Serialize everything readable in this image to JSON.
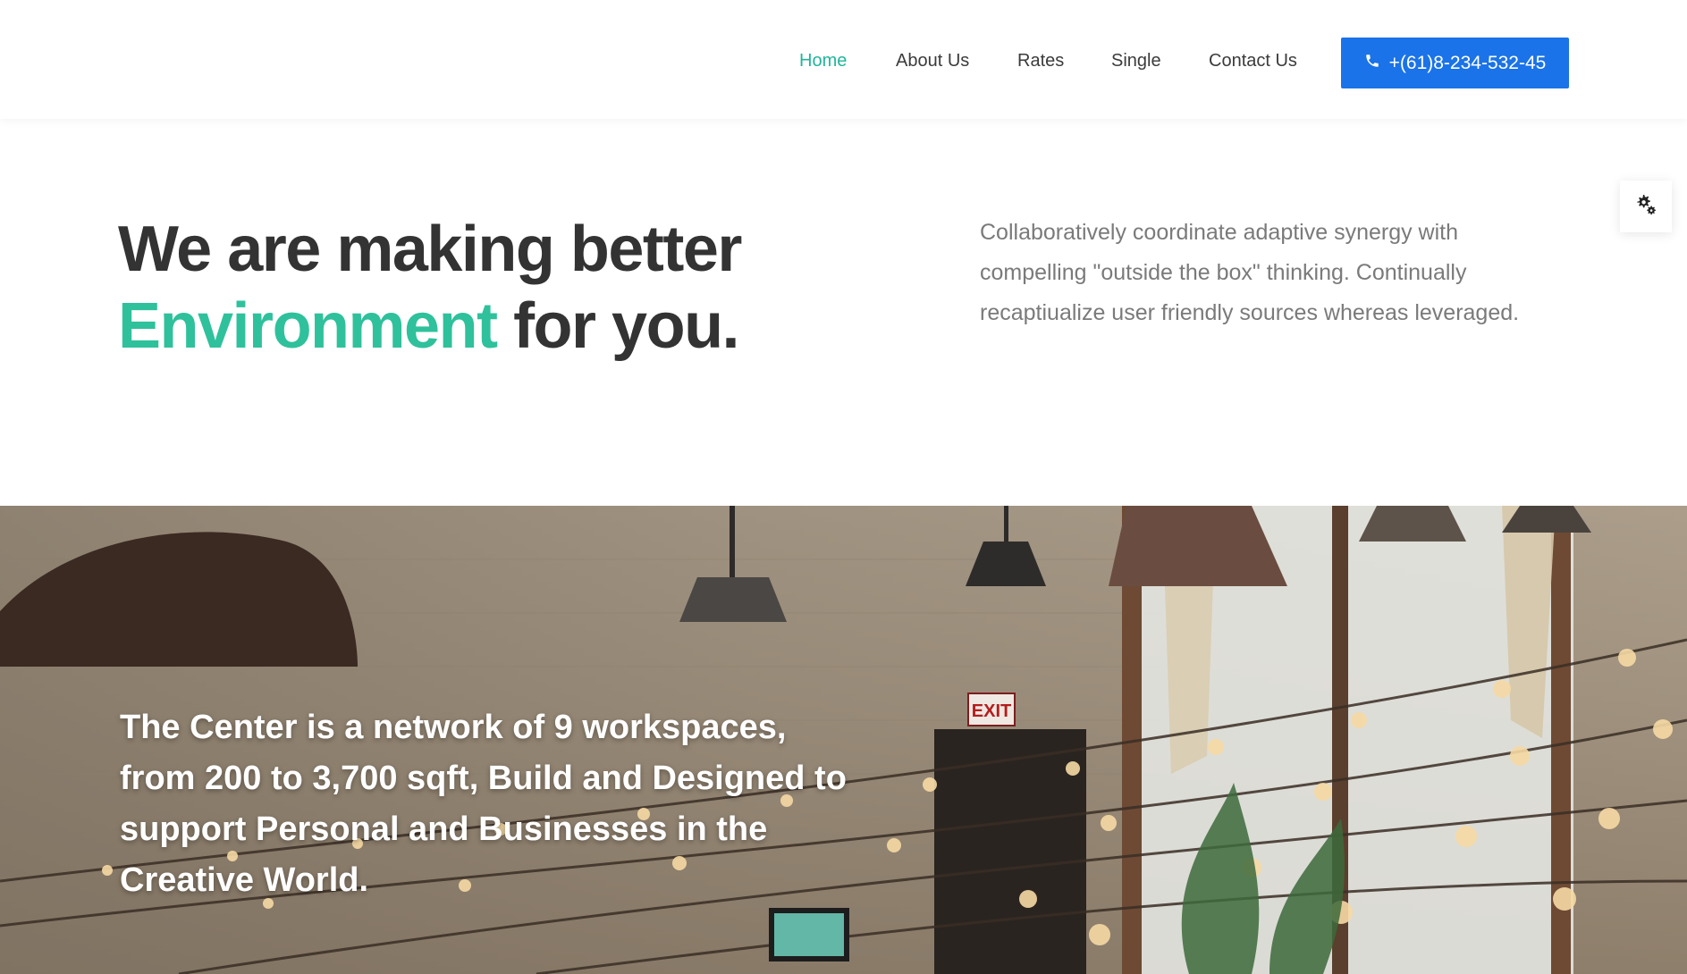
{
  "nav": {
    "items": [
      {
        "label": "Home",
        "active": true
      },
      {
        "label": "About Us",
        "active": false
      },
      {
        "label": "Rates",
        "active": false
      },
      {
        "label": "Single",
        "active": false
      },
      {
        "label": "Contact Us",
        "active": false
      }
    ],
    "phone_label": "+(61)8-234-532-45",
    "phone_icon": "phone-icon"
  },
  "hero": {
    "title_line1": "We are making better",
    "title_accent": "Environment",
    "title_rest": " for you.",
    "description": "Collaboratively coordinate adaptive synergy with compelling \"outside the box\" thinking. Continually recaptiualize user friendly sources whereas leveraged."
  },
  "settings": {
    "icon": "gear-icon"
  },
  "banner": {
    "text": "The Center is a network of 9 workspaces, from 200 to 3,700 sqft, Build and Designed to support Personal and Businesses in the Creative World.",
    "sign_text": "EXIT"
  },
  "colors": {
    "accent_green": "#2fc19b",
    "nav_active": "#21b59a",
    "button_blue": "#1a73e8",
    "heading": "#333333",
    "body_text": "#7a7a7a"
  }
}
